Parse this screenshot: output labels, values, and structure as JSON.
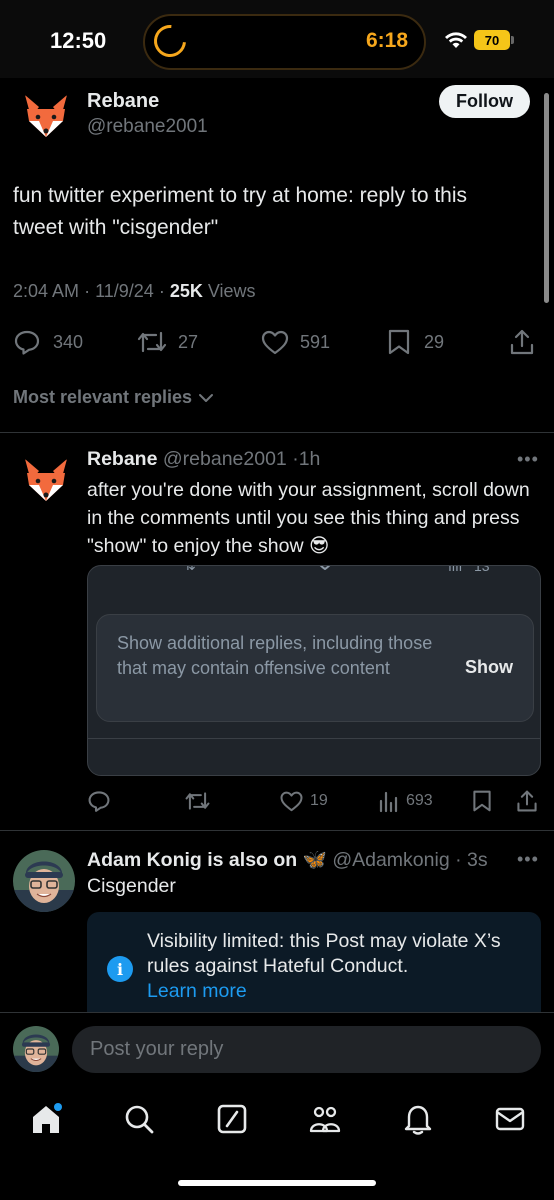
{
  "status_bar": {
    "time": "12:50",
    "activity_time": "6:18",
    "battery": "70",
    "icons": [
      "timer-ring-icon",
      "wifi-icon",
      "battery-icon"
    ]
  },
  "tweet": {
    "author_name": "Rebane",
    "author_handle": "@rebane2001",
    "follow_label": "Follow",
    "text": "fun twitter experiment to try at home: reply to this tweet with \"cisgender\"",
    "time": "2:04 AM",
    "date": "11/9/24",
    "views_count": "25K",
    "views_label": "Views",
    "actions": {
      "replies": "340",
      "reposts": "27",
      "likes": "591",
      "bookmarks": "29"
    }
  },
  "replies_filter": "Most relevant replies",
  "reply_1": {
    "author_name": "Rebane",
    "author_handle": "@rebane2001",
    "age": "1h",
    "text": "after you're done with your assignment, scroll down in the comments until you see this thing and press \"show\" to enjoy the show 😎",
    "embedded": {
      "top_stat": "13",
      "notice": "Show additional replies, including those that may contain offensive content",
      "show_label": "Show"
    },
    "actions": {
      "likes": "19",
      "views": "693"
    }
  },
  "reply_2": {
    "author_name": "Adam Konig is also on",
    "author_badge": "🦋",
    "author_handle": "@Adamkonig",
    "age": "3s",
    "text": "Cisgender",
    "visibility_notice": "Visibility limited: this Post may violate X’s rules against Hateful Conduct.",
    "learn_more": "Learn more"
  },
  "compose": {
    "placeholder": "Post your reply"
  },
  "nav": [
    "home-icon",
    "search-icon",
    "grok-icon",
    "communities-icon",
    "notifications-icon",
    "messages-icon"
  ],
  "colors": {
    "background": "#000000",
    "accent": "#1d9bf0",
    "muted": "#71767b",
    "text": "#e7e9ea"
  }
}
